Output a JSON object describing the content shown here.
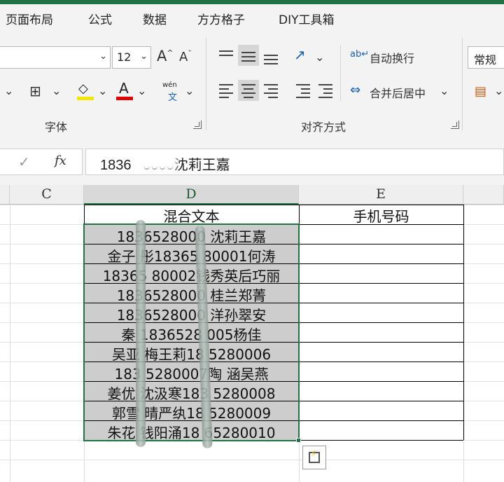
{
  "menu": {
    "items": [
      "页面布局",
      "公式",
      "数据",
      "方方格子",
      "DIY工具箱"
    ]
  },
  "ribbon": {
    "font_size": "12",
    "grow_font_label": "A",
    "shrink_font_label": "A",
    "phonetic_label": "wén",
    "phonetic_char": "文",
    "wrap_text_label": "自动换行",
    "merge_center_label": "合并后居中",
    "number_format": "常规",
    "font_group_label": "字体",
    "align_group_label": "对齐方式",
    "colors": {
      "highlight": "#f5e600",
      "font_color": "#e00000",
      "accent": "#217346"
    }
  },
  "formula_bar": {
    "check_glyph": "✓",
    "fx_glyph": "fx",
    "content": "1836   0000沈莉王嘉"
  },
  "sheet": {
    "columns": [
      "C",
      "D",
      "E"
    ],
    "headers": {
      "d": "混合文本",
      "e": "手机号码"
    },
    "rows": [
      "1836528000 沈莉王嘉",
      "金子 彤18365 80001何涛",
      "18365 80002钱秀英后巧丽",
      "1836528000 桂兰郑菁",
      "1836528000 洋孙翠安",
      "秦 1836528 005杨佳",
      "吴亚 梅王莉18 5280006",
      "183 5280007陶 涵吴燕",
      "姜优 沈汲寒183 5280008",
      "郭雪 晴严纨18 5280009",
      "朱花 钱阳涌18 65280010"
    ]
  }
}
